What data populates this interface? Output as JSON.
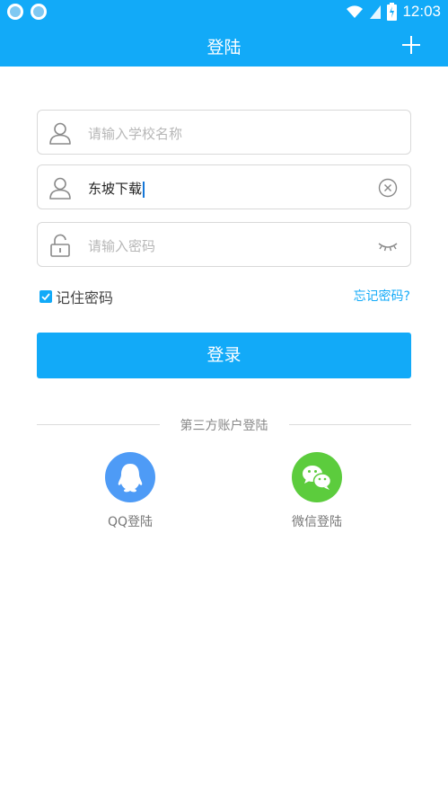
{
  "status_bar": {
    "time": "12:03"
  },
  "app_bar": {
    "title": "登陆",
    "add_icon": "plus-icon"
  },
  "form": {
    "school_field": {
      "placeholder": "请输入学校名称",
      "value": "",
      "icon": "user-icon"
    },
    "username_field": {
      "value": "东坡下载",
      "icon": "user-icon",
      "clear_icon": "clear-icon"
    },
    "password_field": {
      "placeholder": "请输入密码",
      "value": "",
      "icon": "lock-icon",
      "visibility_icon": "eye-closed-icon"
    },
    "remember_password": {
      "label": "记住密码",
      "checked": true
    },
    "forgot_password": "忘记密码?",
    "login_button": "登录"
  },
  "third_party": {
    "heading": "第三方账户登陆",
    "qq": {
      "label": "QQ登陆",
      "color": "#4e9bf6",
      "icon": "qq-icon"
    },
    "wechat": {
      "label": "微信登陆",
      "color": "#5ccc3d",
      "icon": "wechat-icon"
    }
  },
  "colors": {
    "primary": "#12aaf8",
    "border": "#d9d9d9",
    "placeholder": "#b7b7b7"
  }
}
